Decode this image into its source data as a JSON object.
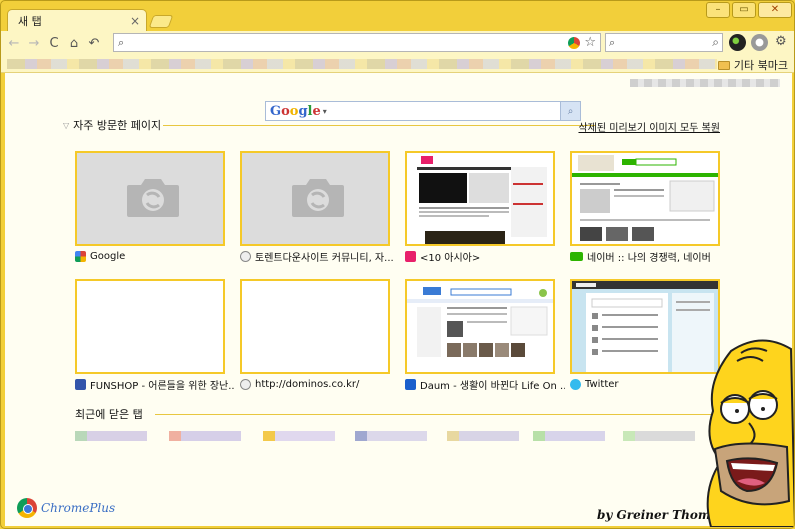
{
  "window": {
    "tab_title": "새 탭",
    "tab_close": "×",
    "controls": [
      "–",
      "▭",
      "✕"
    ]
  },
  "toolbar": {
    "back": "←",
    "forward": "→",
    "reload": "C",
    "home": "⌂",
    "undo": "↶",
    "omnibox_value": "",
    "search_value": "",
    "search_go": "⌕",
    "wrench": "🔧"
  },
  "bookmarks": {
    "other_label": "기타 북마크"
  },
  "google": {
    "logo": [
      "G",
      "o",
      "o",
      "g",
      "l",
      "e"
    ],
    "caret": "▾",
    "button": "⌕"
  },
  "most_visited": {
    "title": "자주 방문한 페이지",
    "restore_link": "삭제된 미리보기 이미지 모두 복원",
    "tiles": [
      {
        "label": "Google",
        "favicon": "google-icon",
        "fav_color": "#3a7bd5",
        "type": "empty"
      },
      {
        "label": "토렌트다운사이트 커뮤니티, 자...",
        "favicon": "globe-icon",
        "fav_color": "#888888",
        "type": "empty"
      },
      {
        "label": "<10 아시아>",
        "favicon": "ten-asia-icon",
        "fav_color": "#e8206a",
        "type": "tenasia"
      },
      {
        "label": "네이버 :: 나의 경쟁력, 네이버",
        "favicon": "naver-icon",
        "fav_color": "#2db400",
        "type": "naver"
      },
      {
        "label": "FUNSHOP - 어른들을 위한 장난...",
        "favicon": "funshop-icon",
        "fav_color": "#3355aa",
        "type": "blank"
      },
      {
        "label": "http://dominos.co.kr/",
        "favicon": "globe-icon",
        "fav_color": "#888888",
        "type": "blank"
      },
      {
        "label": "Daum - 생활이 바뀐다 Life On ...",
        "favicon": "daum-icon",
        "fav_color": "#1a5fcc",
        "type": "daum"
      },
      {
        "label": "Twitter",
        "favicon": "twitter-icon",
        "fav_color": "#33bbee",
        "type": "twitter"
      }
    ]
  },
  "recent": {
    "title": "최근에 닫은 탭"
  },
  "branding": {
    "chromeplus": "ChromePlus",
    "credit": "by Greiner Thomas"
  }
}
